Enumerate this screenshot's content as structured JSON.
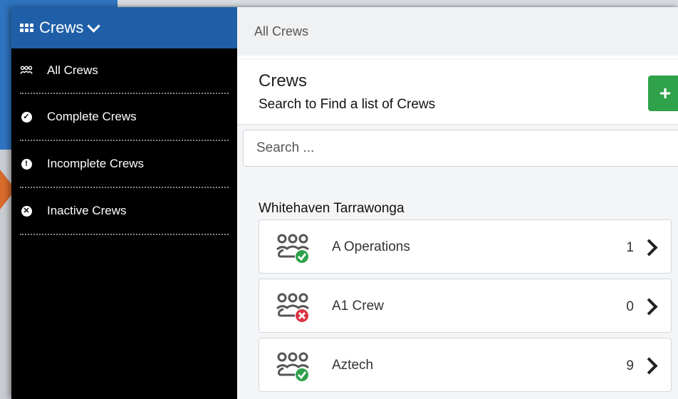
{
  "sidebar": {
    "header_label": "Crews",
    "items": [
      {
        "label": "All Crews",
        "icon": "users-icon"
      },
      {
        "label": "Complete Crews",
        "icon": "check-circle-icon"
      },
      {
        "label": "Incomplete Crews",
        "icon": "exclamation-circle-icon"
      },
      {
        "label": "Inactive Crews",
        "icon": "x-circle-icon"
      }
    ]
  },
  "main": {
    "breadcrumb": "All Crews",
    "title": "Crews",
    "subtitle": "Search to Find a list of Crews",
    "add_button_label": "+",
    "search": {
      "placeholder": "Search ...",
      "value": ""
    },
    "group_title": "Whitehaven Tarrawonga",
    "crews": [
      {
        "name": "A Operations",
        "count": "1",
        "status": "complete",
        "status_color": "#2fa24b"
      },
      {
        "name": "A1 Crew",
        "count": "0",
        "status": "inactive",
        "status_color": "#dc3545"
      },
      {
        "name": "Aztech",
        "count": "9",
        "status": "complete",
        "status_color": "#2fa24b"
      }
    ]
  },
  "colors": {
    "header_blue": "#1f5fa8",
    "add_green": "#2fa24b"
  }
}
